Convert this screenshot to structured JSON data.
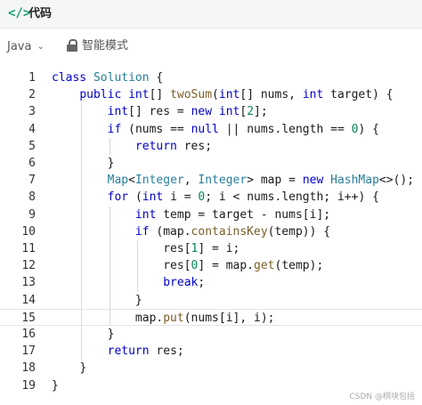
{
  "header": {
    "icon": "code-icon",
    "icon_glyph": "</>",
    "title": "代码"
  },
  "toolbar": {
    "language": "Java",
    "chevron": "⌄",
    "lock_icon": "lock-icon",
    "mode_label": "智能模式"
  },
  "code": {
    "lines": [
      {
        "n": "1",
        "text": "class Solution {"
      },
      {
        "n": "2",
        "text": "    public int[] twoSum(int[] nums, int target) {"
      },
      {
        "n": "3",
        "text": "        int[] res = new int[2];"
      },
      {
        "n": "4",
        "text": "        if (nums == null || nums.length == 0) {"
      },
      {
        "n": "5",
        "text": "            return res;"
      },
      {
        "n": "6",
        "text": "        }"
      },
      {
        "n": "7",
        "text": "        Map<Integer, Integer> map = new HashMap<>();"
      },
      {
        "n": "8",
        "text": "        for (int i = 0; i < nums.length; i++) {"
      },
      {
        "n": "9",
        "text": "            int temp = target - nums[i];"
      },
      {
        "n": "10",
        "text": "            if (map.containsKey(temp)) {"
      },
      {
        "n": "11",
        "text": "                res[1] = i;"
      },
      {
        "n": "12",
        "text": "                res[0] = map.get(temp);"
      },
      {
        "n": "13",
        "text": "                break;"
      },
      {
        "n": "14",
        "text": "            }"
      },
      {
        "n": "15",
        "text": "            map.put(nums[i], i);"
      },
      {
        "n": "16",
        "text": "        }"
      },
      {
        "n": "17",
        "text": "        return res;"
      },
      {
        "n": "18",
        "text": "    }"
      },
      {
        "n": "19",
        "text": "}"
      }
    ],
    "active_line": "15"
  },
  "watermark": "CSDN @棋块包括",
  "colors": {
    "accent_green": "#15a36b",
    "keyword": "#0000cc",
    "class": "#267f99",
    "number": "#098658"
  }
}
